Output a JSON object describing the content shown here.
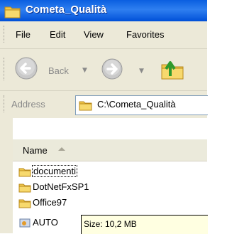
{
  "window": {
    "title": "Cometa_Qualità"
  },
  "menu": {
    "items": [
      "File",
      "Edit",
      "View",
      "Favorites"
    ]
  },
  "toolbar": {
    "back_label": "Back"
  },
  "address": {
    "label": "Address",
    "value": "C:\\Cometa_Qualità"
  },
  "list": {
    "header": "Name",
    "items": [
      {
        "name": "documenti",
        "type": "folder"
      },
      {
        "name": "DotNetFxSP1",
        "type": "folder"
      },
      {
        "name": "Office97",
        "type": "folder"
      },
      {
        "name": "AUTO",
        "type": "file"
      }
    ]
  },
  "tooltip": {
    "text": "Size: 10,2 MB"
  },
  "colors": {
    "titlebar": "#0a5fe0",
    "chrome": "#ece9d8",
    "tooltip_bg": "#ffffe1"
  }
}
